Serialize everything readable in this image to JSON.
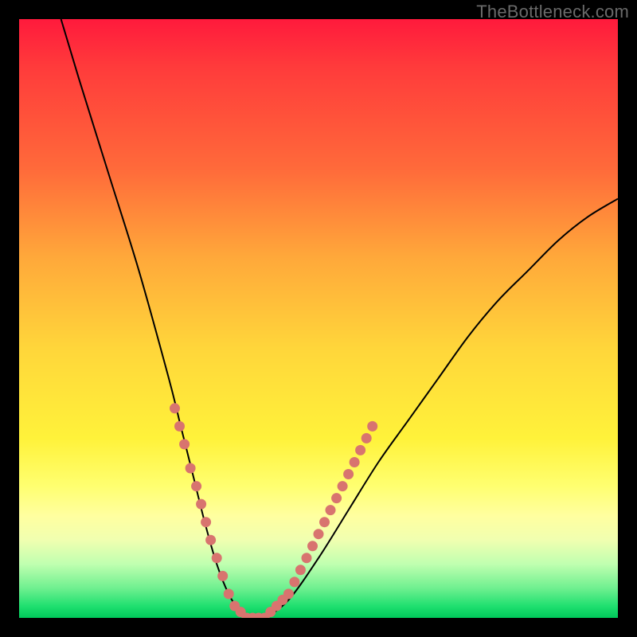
{
  "watermark": "TheBottleneck.com",
  "colors": {
    "background": "#000000",
    "gradient_top": "#ff1a3c",
    "gradient_bottom": "#00c85a",
    "curve": "#000000",
    "dots": "#d8746f"
  },
  "chart_data": {
    "type": "line",
    "title": "",
    "xlabel": "",
    "ylabel": "",
    "xlim": [
      0,
      100
    ],
    "ylim": [
      0,
      100
    ],
    "series": [
      {
        "name": "bottleneck-curve",
        "x": [
          7,
          10,
          15,
          20,
          25,
          27,
          29,
          31,
          33,
          35,
          37,
          39,
          41,
          45,
          50,
          55,
          60,
          65,
          70,
          75,
          80,
          85,
          90,
          95,
          100
        ],
        "y": [
          100,
          90,
          74,
          58,
          40,
          32,
          24,
          16,
          9,
          4,
          1,
          0,
          0,
          3,
          10,
          18,
          26,
          33,
          40,
          47,
          53,
          58,
          63,
          67,
          70
        ]
      }
    ],
    "markers": {
      "name": "highlight-dots",
      "points": [
        {
          "x": 26.0,
          "y": 35
        },
        {
          "x": 26.8,
          "y": 32
        },
        {
          "x": 27.6,
          "y": 29
        },
        {
          "x": 28.6,
          "y": 25
        },
        {
          "x": 29.6,
          "y": 22
        },
        {
          "x": 30.4,
          "y": 19
        },
        {
          "x": 31.2,
          "y": 16
        },
        {
          "x": 32.0,
          "y": 13
        },
        {
          "x": 33.0,
          "y": 10
        },
        {
          "x": 34.0,
          "y": 7
        },
        {
          "x": 35.0,
          "y": 4
        },
        {
          "x": 36.0,
          "y": 2
        },
        {
          "x": 37.0,
          "y": 1
        },
        {
          "x": 38.0,
          "y": 0
        },
        {
          "x": 39.0,
          "y": 0
        },
        {
          "x": 40.0,
          "y": 0
        },
        {
          "x": 41.0,
          "y": 0
        },
        {
          "x": 42.0,
          "y": 1
        },
        {
          "x": 43.0,
          "y": 2
        },
        {
          "x": 44.0,
          "y": 3
        },
        {
          "x": 45.0,
          "y": 4
        },
        {
          "x": 46.0,
          "y": 6
        },
        {
          "x": 47.0,
          "y": 8
        },
        {
          "x": 48.0,
          "y": 10
        },
        {
          "x": 49.0,
          "y": 12
        },
        {
          "x": 50.0,
          "y": 14
        },
        {
          "x": 51.0,
          "y": 16
        },
        {
          "x": 52.0,
          "y": 18
        },
        {
          "x": 53.0,
          "y": 20
        },
        {
          "x": 54.0,
          "y": 22
        },
        {
          "x": 55.0,
          "y": 24
        },
        {
          "x": 56.0,
          "y": 26
        },
        {
          "x": 57.0,
          "y": 28
        },
        {
          "x": 58.0,
          "y": 30
        },
        {
          "x": 59.0,
          "y": 32
        }
      ]
    }
  }
}
